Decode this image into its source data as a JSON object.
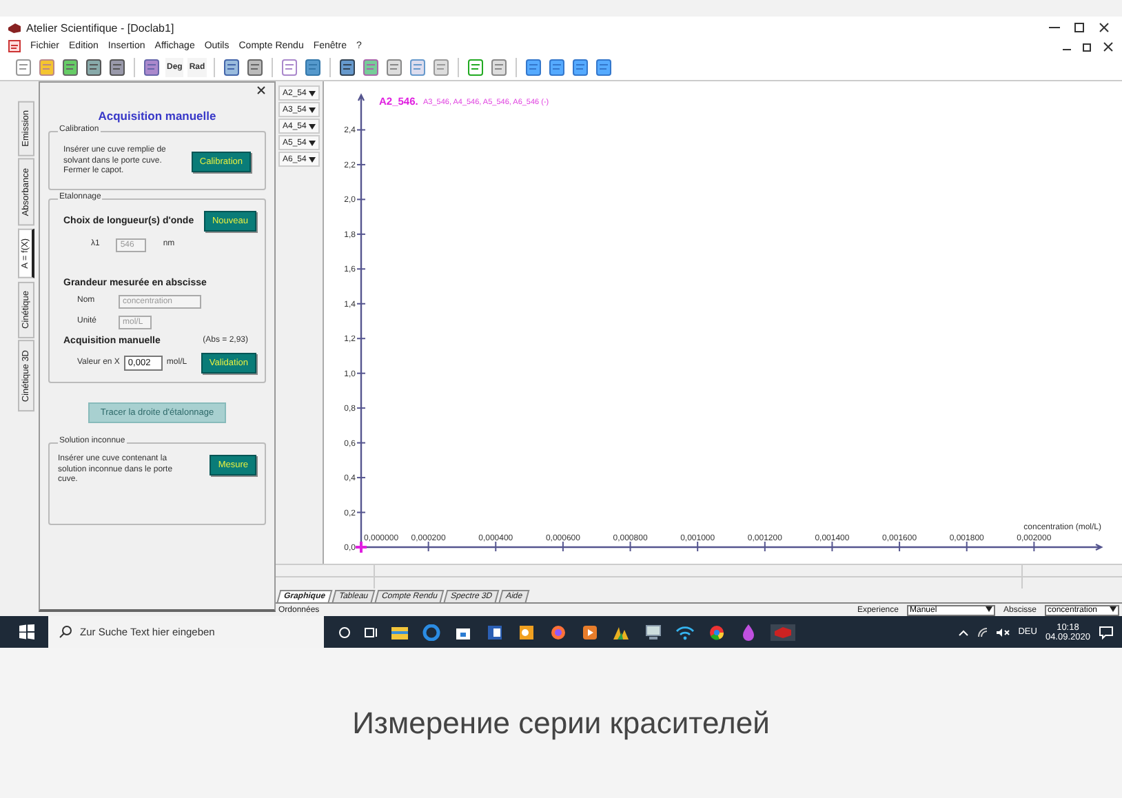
{
  "window": {
    "title": "Atelier Scientifique - [Doclab1]"
  },
  "menu": [
    "Fichier",
    "Edition",
    "Insertion",
    "Affichage",
    "Outils",
    "Compte Rendu",
    "Fenêtre",
    "?"
  ],
  "toolbar": {
    "deg": "Deg",
    "rad": "Rad"
  },
  "side_tabs": [
    {
      "label": "Emission",
      "selected": false
    },
    {
      "label": "Absorbance",
      "selected": false
    },
    {
      "label": "A = f(X)",
      "selected": true
    },
    {
      "label": "Cinétique",
      "selected": false
    },
    {
      "label": "Cinétique 3D",
      "selected": false
    }
  ],
  "panel": {
    "title": "Acquisition manuelle",
    "calibration": {
      "legend": "Calibration",
      "text": "Insérer une cuve remplie de\nsolvant dans le porte  cuve.\nFermer le capot.",
      "button": "Calibration"
    },
    "etalonnage": {
      "legend": "Etalonnage",
      "wavelength_heading": "Choix de longueur(s) d'onde",
      "new_button": "Nouveau",
      "lambda_label": "λ1",
      "lambda_value": "546",
      "lambda_unit": "nm",
      "abscissa_heading": "Grandeur mesurée en abscisse",
      "name_label": "Nom",
      "name_value": "concentration",
      "unit_label": "Unité",
      "unit_value": "mol/L",
      "acquisition_heading": "Acquisition manuelle",
      "abs_reading": "(Abs = 2,93)",
      "x_label": "Valeur en X",
      "x_value": "0,002",
      "x_unit": "mol/L",
      "validate_button": "Validation"
    },
    "plot_button": {
      "label": "Tracer la droite d'étalonnage",
      "disabled": true
    },
    "unknown": {
      "legend": "Solution inconnue",
      "text": "Insérer une cuve contenant la\nsolution inconnue dans le porte\ncuve.",
      "button": "Mesure"
    }
  },
  "series_selects": [
    "A2_54",
    "A3_54",
    "A4_54",
    "A5_54",
    "A6_54"
  ],
  "chart": {
    "legend_active": "A2_546.",
    "legend_others": "A3_546, A4_546, A5_546, A6_546 (-)",
    "chart_data": {
      "type": "line",
      "xlabel": "concentration (mol/L)",
      "xlim": [
        0,
        0.0022
      ],
      "ylim": [
        0,
        2.6
      ],
      "xticks": [
        {
          "value": 0,
          "label": "0,000000"
        },
        {
          "value": 0.0002,
          "label": "0,000200"
        },
        {
          "value": 0.0004,
          "label": "0,000400"
        },
        {
          "value": 0.0006,
          "label": "0,000600"
        },
        {
          "value": 0.0008,
          "label": "0,000800"
        },
        {
          "value": 0.001,
          "label": "0,001000"
        },
        {
          "value": 0.0012,
          "label": "0,001200"
        },
        {
          "value": 0.0014,
          "label": "0,001400"
        },
        {
          "value": 0.0016,
          "label": "0,001600"
        },
        {
          "value": 0.0018,
          "label": "0,001800"
        },
        {
          "value": 0.002,
          "label": "0,002000"
        }
      ],
      "yticks": [
        {
          "value": 0,
          "label": "0,0"
        },
        {
          "value": 0.2,
          "label": "0,2"
        },
        {
          "value": 0.4,
          "label": "0,4"
        },
        {
          "value": 0.6,
          "label": "0,6"
        },
        {
          "value": 0.8,
          "label": "0,8"
        },
        {
          "value": 1,
          "label": "1,0"
        },
        {
          "value": 1.2,
          "label": "1,2"
        },
        {
          "value": 1.4,
          "label": "1,4"
        },
        {
          "value": 1.6,
          "label": "1,6"
        },
        {
          "value": 1.8,
          "label": "1,8"
        },
        {
          "value": 2,
          "label": "2,0"
        },
        {
          "value": 2.2,
          "label": "2,2"
        },
        {
          "value": 2.4,
          "label": "2,4"
        }
      ]
    }
  },
  "bottom_tabs": [
    {
      "label": "Graphique",
      "selected": true
    },
    {
      "label": "Tableau",
      "selected": false
    },
    {
      "label": "Compte Rendu",
      "selected": false
    },
    {
      "label": "Spectre 3D",
      "selected": false
    },
    {
      "label": "Aide",
      "selected": false
    }
  ],
  "status": {
    "ordinates": "Ordonnées",
    "experience_label": "Experience",
    "experience_value": "Manuel",
    "abscissa_label": "Abscisse",
    "abscissa_value": "concentration"
  },
  "taskbar": {
    "search_placeholder": "Zur Suche Text hier eingeben",
    "language": "DEU",
    "time": "10:18",
    "date": "04.09.2020"
  },
  "caption": "Измерение серии красителей"
}
